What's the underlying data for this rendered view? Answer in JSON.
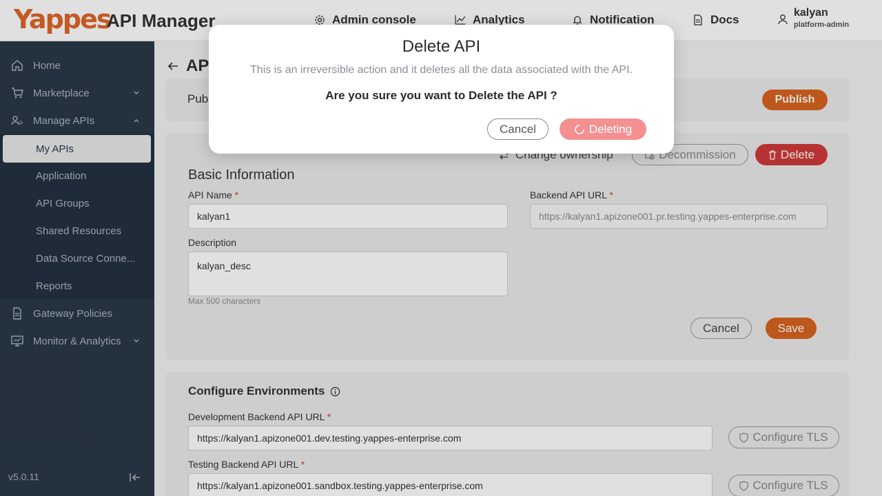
{
  "header": {
    "logo_text": "Yappes",
    "app_title": "API Manager",
    "nav": {
      "admin_console": "Admin console",
      "analytics": "Analytics",
      "notification": "Notification",
      "docs": "Docs"
    },
    "user": {
      "name": "kalyan",
      "role": "platform-admin"
    }
  },
  "sidebar": {
    "items": {
      "home": "Home",
      "marketplace": "Marketplace",
      "manage_apis": "Manage APIs",
      "gateway_policies": "Gateway Policies",
      "monitor_analytics": "Monitor & Analytics"
    },
    "sub_items": {
      "my_apis": "My APIs",
      "application": "Application",
      "api_groups": "API Groups",
      "shared_resources": "Shared Resources",
      "data_source": "Data Source Conne...",
      "reports": "Reports"
    },
    "version": "v5.0.11"
  },
  "main": {
    "page_title": "API",
    "publish_label": "Pub",
    "publish_button": "Publish",
    "actions": {
      "change_ownership": "Change ownership",
      "decommission": "Decommission",
      "delete": "Delete"
    },
    "basic_info": {
      "title": "Basic Information",
      "api_name_label": "API Name",
      "api_name_value": "kalyan1",
      "backend_url_label": "Backend API URL",
      "backend_url_value": "https://kalyan1.apizone001.pr.testing.yappes-enterprise.com",
      "description_label": "Description",
      "description_value": "kalyan_desc",
      "description_hint": "Max 500 characters",
      "cancel": "Cancel",
      "save": "Save",
      "required_mark": "*"
    },
    "environments": {
      "title": "Configure Environments",
      "dev_label": "Development Backend API URL",
      "dev_value": "https://kalyan1.apizone001.dev.testing.yappes-enterprise.com",
      "test_label": "Testing Backend API URL",
      "test_value": "https://kalyan1.apizone001.sandbox.testing.yappes-enterprise.com",
      "configure_tls": "Configure TLS"
    }
  },
  "modal": {
    "title": "Delete API",
    "description": "This is an irreversible action and it deletes all the data associated with the API.",
    "question": "Are you sure you want to Delete the API ?",
    "cancel": "Cancel",
    "deleting": "Deleting"
  },
  "colors": {
    "brand_orange": "#d9631f",
    "sidebar_bg": "#2a3847",
    "danger_red": "#d13b3b",
    "deleting_pink": "#f49090"
  }
}
